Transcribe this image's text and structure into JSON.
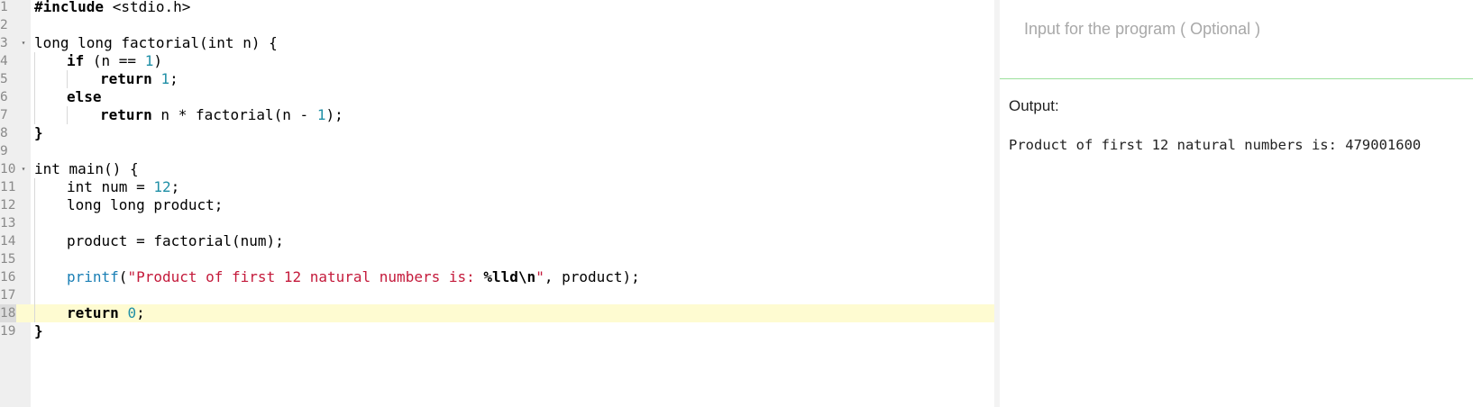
{
  "editor": {
    "active_line": 18,
    "lines": [
      {
        "n": "1"
      },
      {
        "n": "2"
      },
      {
        "n": "3"
      },
      {
        "n": "4"
      },
      {
        "n": "5"
      },
      {
        "n": "6"
      },
      {
        "n": "7"
      },
      {
        "n": "8"
      },
      {
        "n": "9"
      },
      {
        "n": "10"
      },
      {
        "n": "11"
      },
      {
        "n": "12"
      },
      {
        "n": "13"
      },
      {
        "n": "14"
      },
      {
        "n": "15"
      },
      {
        "n": "16"
      },
      {
        "n": "17"
      },
      {
        "n": "18"
      },
      {
        "n": "19"
      }
    ],
    "tokens": {
      "l1_kw": "#include",
      "l1_rest": " <stdio.h>",
      "l3_text": "long long factorial(int n) {",
      "l4_kw": "if",
      "l4_a": " (n == ",
      "l4_num": "1",
      "l4_b": ")",
      "l5_kw": "return",
      "l5_a": " ",
      "l5_num": "1",
      "l5_b": ";",
      "l6_kw": "else",
      "l7_kw": "return",
      "l7_a": " n * factorial(n - ",
      "l7_num": "1",
      "l7_b": ");",
      "l8_text": "}",
      "l10_text": "int main() {",
      "l11_a": "int num = ",
      "l11_num": "12",
      "l11_b": ";",
      "l12_text": "long long product;",
      "l14_text": "product = factorial(num);",
      "l16_fn": "printf",
      "l16_a": "(",
      "l16_str": "\"Product of first 12 natural numbers is: ",
      "l16_esc": "%lld\\n",
      "l16_str2": "\"",
      "l16_b": ", product);",
      "l18_kw": "return",
      "l18_a": " ",
      "l18_num": "0",
      "l18_b": ";",
      "l19_text": "}"
    },
    "fold_markers": {
      "line3": "▾",
      "line10": "▾"
    }
  },
  "input": {
    "placeholder": "Input for the program ( Optional )",
    "value": ""
  },
  "output": {
    "label": "Output:",
    "text": "Product of first 12 natural numbers is: 479001600"
  },
  "colors": {
    "active_line_bg": "#fefbd1",
    "number": "#1f8fa6",
    "string": "#c41a3b",
    "function": "#1a7fb5",
    "input_border": "#9be09b"
  }
}
